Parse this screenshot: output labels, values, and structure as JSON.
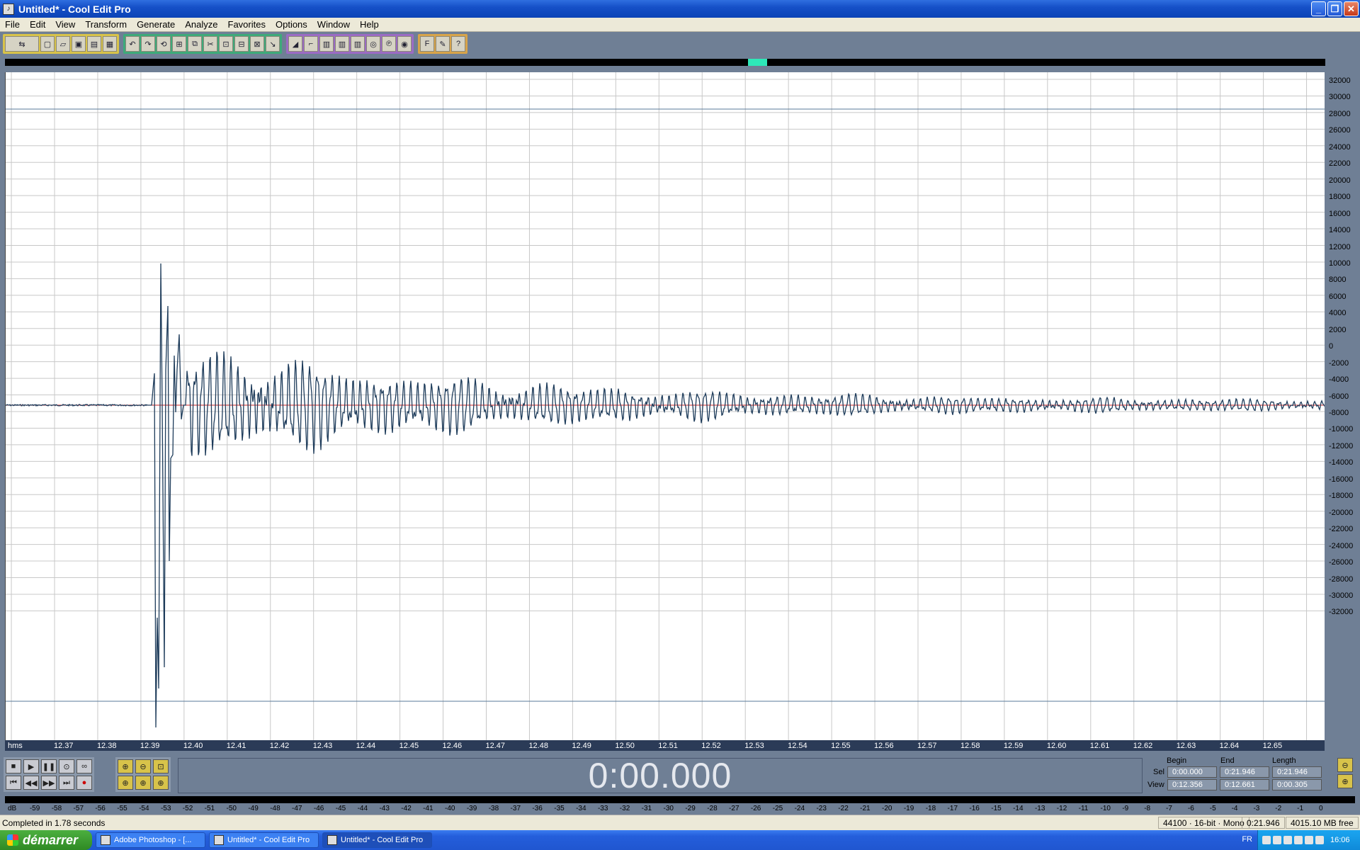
{
  "window": {
    "title": "Untitled* - Cool Edit Pro",
    "app_icon": "cool-edit-icon",
    "buttons": [
      "minimize",
      "restore",
      "close"
    ]
  },
  "menu": [
    "File",
    "Edit",
    "View",
    "Transform",
    "Generate",
    "Analyze",
    "Favorites",
    "Options",
    "Window",
    "Help"
  ],
  "toolbar": {
    "groups": [
      {
        "color": "yellow",
        "icons": [
          "multitrack-toggle-icon",
          "new-file-icon",
          "open-file-icon",
          "save-icon",
          "save-as-icon",
          "save-selection-icon"
        ]
      },
      {
        "color": "green",
        "icons": [
          "undo-icon",
          "redo-icon",
          "repeat-icon",
          "copy-to-new-icon",
          "copy-icon",
          "cut-icon",
          "paste-icon",
          "paste-new-icon",
          "mix-paste-icon",
          "trim-icon"
        ]
      },
      {
        "color": "purple",
        "icons": [
          "envelope-icon",
          "normalize-icon",
          "grid-1-icon",
          "grid-2-icon",
          "grid-3-icon",
          "frequency-icon",
          "pitch-icon",
          "cd-icon"
        ]
      },
      {
        "color": "orange",
        "icons": [
          "favorites-icon",
          "settings-icon",
          "help-icon"
        ]
      }
    ]
  },
  "overview": {
    "view_start_fraction": 0.563,
    "view_width_fraction": 0.014
  },
  "waveform": {
    "amplitude_scale": [
      "32000",
      "30000",
      "28000",
      "26000",
      "24000",
      "22000",
      "20000",
      "18000",
      "16000",
      "14000",
      "12000",
      "10000",
      "8000",
      "6000",
      "4000",
      "2000",
      "0",
      "-2000",
      "-4000",
      "-6000",
      "-8000",
      "-10000",
      "-12000",
      "-14000",
      "-16000",
      "-18000",
      "-20000",
      "-22000",
      "-24000",
      "-26000",
      "-28000",
      "-30000",
      "-32000"
    ],
    "time_ruler_unit": "hms",
    "time_ruler": [
      "12.37",
      "12.38",
      "12.39",
      "12.40",
      "12.41",
      "12.42",
      "12.43",
      "12.44",
      "12.45",
      "12.46",
      "12.47",
      "12.48",
      "12.49",
      "12.50",
      "12.51",
      "12.52",
      "12.53",
      "12.54",
      "12.55",
      "12.56",
      "12.57",
      "12.58",
      "12.59",
      "12.60",
      "12.61",
      "12.62",
      "12.63",
      "12.64",
      "12.65"
    ],
    "colors": {
      "background": "#ffffff",
      "wave": "#1d3b5a",
      "center_line": "#cc2222",
      "grid": "#c8c8c8"
    }
  },
  "transport": {
    "buttons": [
      "stop-icon",
      "play-icon",
      "pause-icon",
      "play-to-end-icon",
      "loop-icon",
      "go-to-start-icon",
      "rewind-icon",
      "fast-forward-icon",
      "go-to-end-icon",
      "record-icon"
    ],
    "zoom_buttons": [
      "zoom-in-horizontal-icon",
      "zoom-out-horizontal-icon",
      "zoom-full-icon",
      "zoom-selection-left-icon",
      "zoom-selection-icon",
      "zoom-selection-right-icon"
    ],
    "time_display": "0:00.000"
  },
  "selection_info": {
    "headers": [
      "Begin",
      "End",
      "Length"
    ],
    "rows": [
      {
        "label": "Sel",
        "begin": "0:00.000",
        "end": "0:21.946",
        "length": "0:21.946"
      },
      {
        "label": "View",
        "begin": "0:12.356",
        "end": "0:12.661",
        "length": "0:00.305"
      }
    ]
  },
  "level_meter": [
    "dB",
    "-59",
    "-58",
    "-57",
    "-56",
    "-55",
    "-54",
    "-53",
    "-52",
    "-51",
    "-50",
    "-49",
    "-48",
    "-47",
    "-46",
    "-45",
    "-44",
    "-43",
    "-42",
    "-41",
    "-40",
    "-39",
    "-38",
    "-37",
    "-36",
    "-35",
    "-34",
    "-33",
    "-32",
    "-31",
    "-30",
    "-29",
    "-28",
    "-27",
    "-26",
    "-25",
    "-24",
    "-23",
    "-22",
    "-21",
    "-20",
    "-19",
    "-18",
    "-17",
    "-16",
    "-15",
    "-14",
    "-13",
    "-12",
    "-11",
    "-10",
    "-9",
    "-8",
    "-7",
    "-6",
    "-5",
    "-4",
    "-3",
    "-2",
    "-1",
    "0"
  ],
  "status": {
    "message": "Completed in 1.78 seconds",
    "format": "44100 · 16-bit · Mono",
    "duration": "0:21.946",
    "free_space": "4015.10 MB free"
  },
  "taskbar": {
    "start_label": "démarrer",
    "tasks": [
      {
        "label": "Adobe Photoshop - [...",
        "active": false
      },
      {
        "label": "Untitled* - Cool Edit Pro",
        "active": false
      },
      {
        "label": "Untitled* - Cool Edit Pro",
        "active": true
      }
    ],
    "language": "FR",
    "clock": "16:06"
  }
}
